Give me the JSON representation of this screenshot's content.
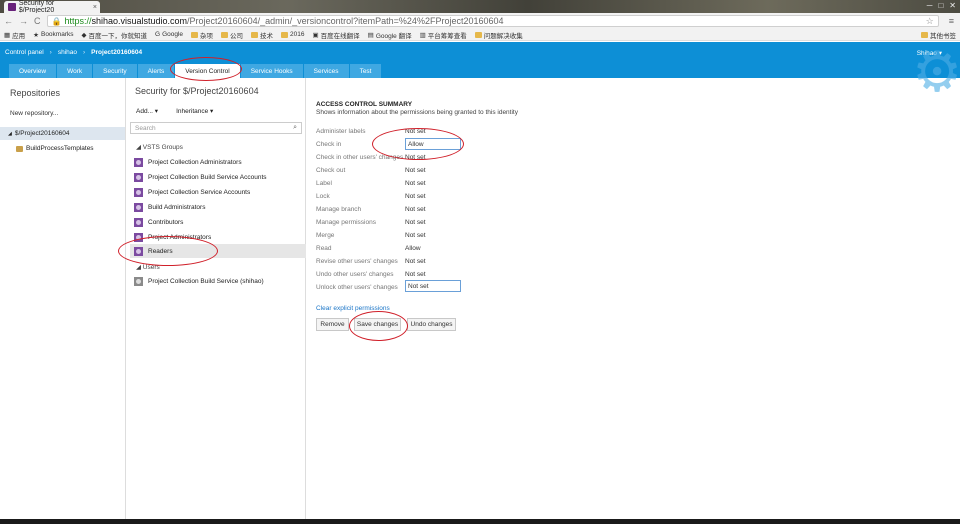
{
  "browser": {
    "tab_title": "Security for $/Project20",
    "tab_close": "×",
    "window_controls": [
      "─",
      "□",
      "✕"
    ],
    "url_scheme": "https://",
    "url_host": "shihao.visualstudio.com",
    "url_path": "/Project20160604/_admin/_versioncontrol?itemPath=%24%2FProject20160604",
    "back_label": "←",
    "forward_label": "→",
    "reload_label": "C",
    "menu_label": "≡",
    "star_label": "☆",
    "bookmarks": [
      "应用",
      "Bookmarks",
      "百度一下，你就知道",
      "Google",
      "杂项",
      "公司",
      "技术",
      "2016",
      "百度在线翻译",
      "Google 翻译",
      "平台筹筹查看",
      "问题解决收集"
    ],
    "other_bookmarks": "其他书签"
  },
  "header": {
    "breadcrumb": [
      "Control panel",
      "shihao",
      "Project20160604"
    ],
    "breadcrumb_sep": "›",
    "user": "Shihao ▾",
    "gear_icon": "⚙",
    "tabs": [
      "Overview",
      "Work",
      "Security",
      "Alerts",
      "Version Control",
      "Service Hooks",
      "Services",
      "Test"
    ],
    "active_tab": "Version Control"
  },
  "left": {
    "title": "Repositories",
    "new_repo": "New repository...",
    "selected_repo": "$/Project20160604",
    "collapse_icon": "◢",
    "child": "BuildProcessTemplates"
  },
  "middle": {
    "title": "Security for $/Project20160604",
    "add_label": "Add... ▾",
    "inheritance_label": "Inheritance ▾",
    "search_placeholder": "Search",
    "search_icon": "⌕",
    "group_header": "◢ VSTS Groups",
    "groups": [
      "Project Collection Administrators",
      "Project Collection Build Service Accounts",
      "Project Collection Service Accounts",
      "Build Administrators",
      "Contributors",
      "Project Administrators",
      "Readers"
    ],
    "selected_group": "Readers",
    "users_header": "◢ Users",
    "users": [
      "Project Collection Build Service (shihao)"
    ]
  },
  "right": {
    "title": "ACCESS CONTROL SUMMARY",
    "subtitle": "Shows information about the permissions being granted to this identity",
    "permissions": [
      {
        "label": "Administer labels",
        "value": "Not set"
      },
      {
        "label": "Check in",
        "value": "Allow"
      },
      {
        "label": "Check in other users' changes",
        "value": "Not set"
      },
      {
        "label": "Check out",
        "value": "Not set"
      },
      {
        "label": "Label",
        "value": "Not set"
      },
      {
        "label": "Lock",
        "value": "Not set"
      },
      {
        "label": "Manage branch",
        "value": "Not set"
      },
      {
        "label": "Manage permissions",
        "value": "Not set"
      },
      {
        "label": "Merge",
        "value": "Not set"
      },
      {
        "label": "Read",
        "value": "Allow"
      },
      {
        "label": "Revise other users' changes",
        "value": "Not set"
      },
      {
        "label": "Undo other users' changes",
        "value": "Not set"
      },
      {
        "label": "Unlock other users' changes",
        "value": "Not set"
      }
    ],
    "clear_link": "Clear explicit permissions",
    "remove_btn": "Remove",
    "save_btn": "Save changes",
    "undo_btn": "Undo changes"
  },
  "colors": {
    "accent": "#0d8fd6",
    "annotation": "#d0202a",
    "group_icon": "#7b4aa0"
  }
}
